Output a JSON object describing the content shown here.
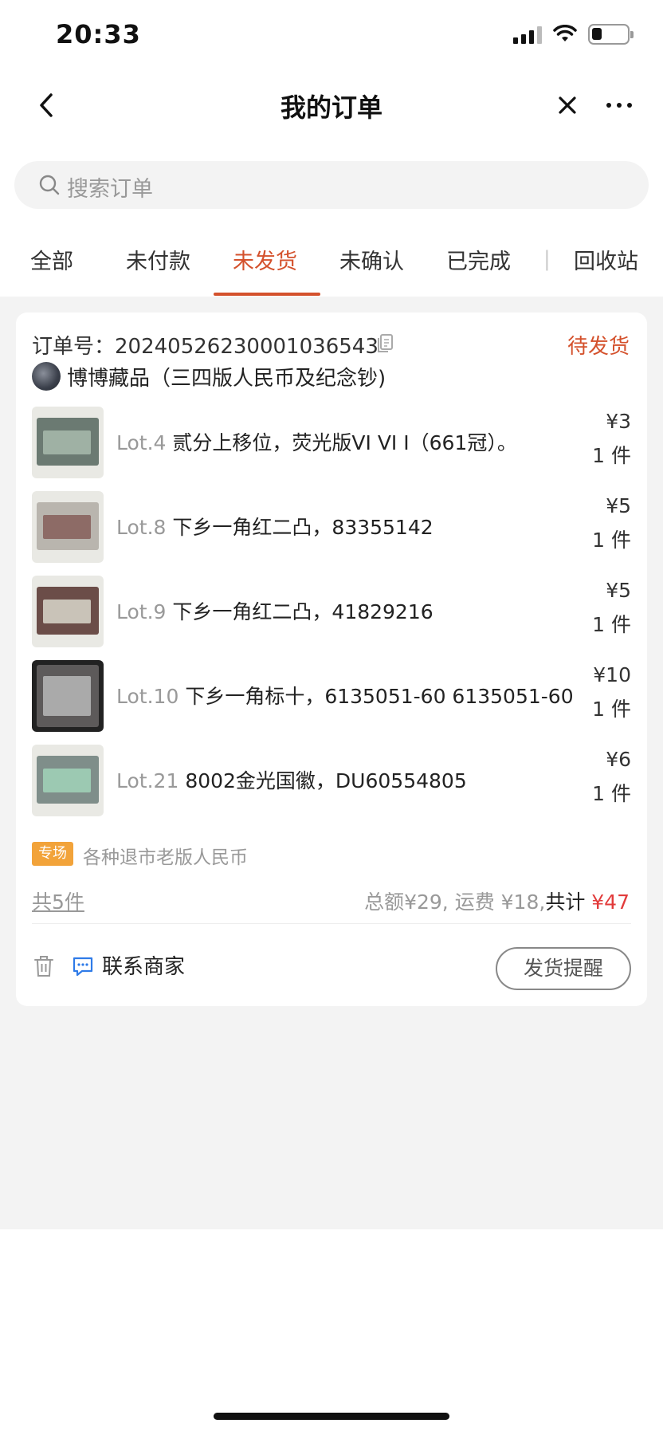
{
  "status_bar": {
    "time": "20:33"
  },
  "nav": {
    "title": "我的订单"
  },
  "search": {
    "placeholder": "搜索订单"
  },
  "tabs": [
    {
      "label": "全部"
    },
    {
      "label": "未付款"
    },
    {
      "label": "未发货",
      "active": true
    },
    {
      "label": "未确认"
    },
    {
      "label": "已完成"
    },
    {
      "label": "回收站"
    }
  ],
  "tab_divider": "|",
  "order": {
    "order_no_label": "订单号：",
    "order_no": "20240526230001036543",
    "status": "待发货",
    "shop_name": "博博藏品（三四版人民币及纪念钞)",
    "items": [
      {
        "lot": "Lot.4",
        "title": "贰分上移位，荧光版VI VI I（661冠）。",
        "price": "¥3",
        "qty": "1 件"
      },
      {
        "lot": "Lot.8",
        "title": "下乡一角红二凸，83355142",
        "price": "¥5",
        "qty": "1 件"
      },
      {
        "lot": "Lot.9",
        "title": "下乡一角红二凸，41829216",
        "price": "¥5",
        "qty": "1 件"
      },
      {
        "lot": "Lot.10",
        "title": "下乡一角标十，6135051-60 6135051-60",
        "price": "¥10",
        "qty": "1 件"
      },
      {
        "lot": "Lot.21",
        "title": "8002金光国徽，DU60554805",
        "price": "¥6",
        "qty": "1 件"
      }
    ],
    "special_tag": "专场",
    "special_text": "各种退市老版人民币",
    "total_count": "共5件",
    "total_amount": "总额¥29, 运费 ¥18,",
    "total_label": "共计",
    "total_value": "¥47",
    "contact_label": "联系商家",
    "remind_label": "发货提醒"
  },
  "colors": {
    "accent": "#d4512c",
    "price_red": "#e23b3b",
    "tag_orange": "#f2a33a"
  }
}
